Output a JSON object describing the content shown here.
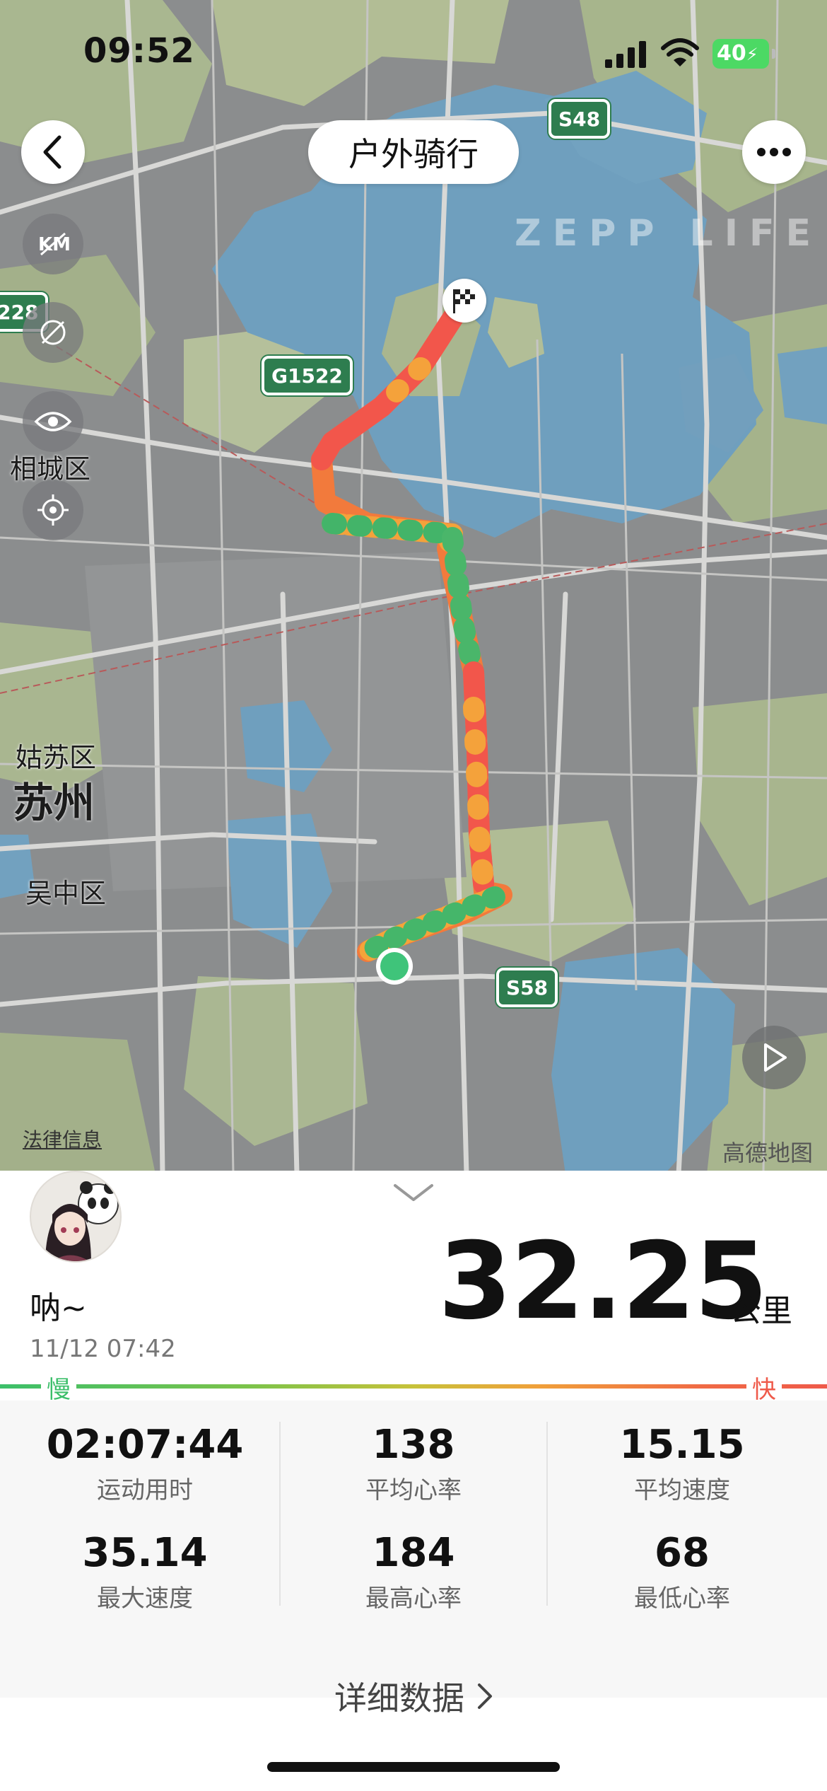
{
  "status_bar": {
    "time": "09:52",
    "battery": "40"
  },
  "header": {
    "title": "户外骑行"
  },
  "map": {
    "watermark": "ZEPP LIFE",
    "labels": {
      "xiangcheng": "相城区",
      "gusu": "姑苏区",
      "suzhou": "苏州",
      "wuzhong": "吴中区"
    },
    "shields": {
      "s48": "S48",
      "g1522": "G1522",
      "s58": "S58",
      "left": "228"
    },
    "legal": "法律信息",
    "provider": "高德地图",
    "tools": [
      "km-icon",
      "no-photo-icon",
      "eye-icon",
      "locate-icon"
    ]
  },
  "summary": {
    "user_name": "呐~",
    "datetime": "11/12 07:42",
    "distance": "32.25",
    "distance_unit": "公里",
    "speed_slow": "慢",
    "speed_fast": "快"
  },
  "stats": [
    {
      "value": "02:07:44",
      "label": "运动用时"
    },
    {
      "value": "138",
      "label": "平均心率"
    },
    {
      "value": "15.15",
      "label": "平均速度"
    },
    {
      "value": "35.14",
      "label": "最大速度"
    },
    {
      "value": "184",
      "label": "最高心率"
    },
    {
      "value": "68",
      "label": "最低心率"
    }
  ],
  "detail_link": "详细数据",
  "colors": {
    "slow": "#3cbf6a",
    "fast": "#ef5a4a",
    "route_hot": "#f0554a",
    "route_mid": "#f4a03a",
    "route_cool": "#45b66a"
  }
}
